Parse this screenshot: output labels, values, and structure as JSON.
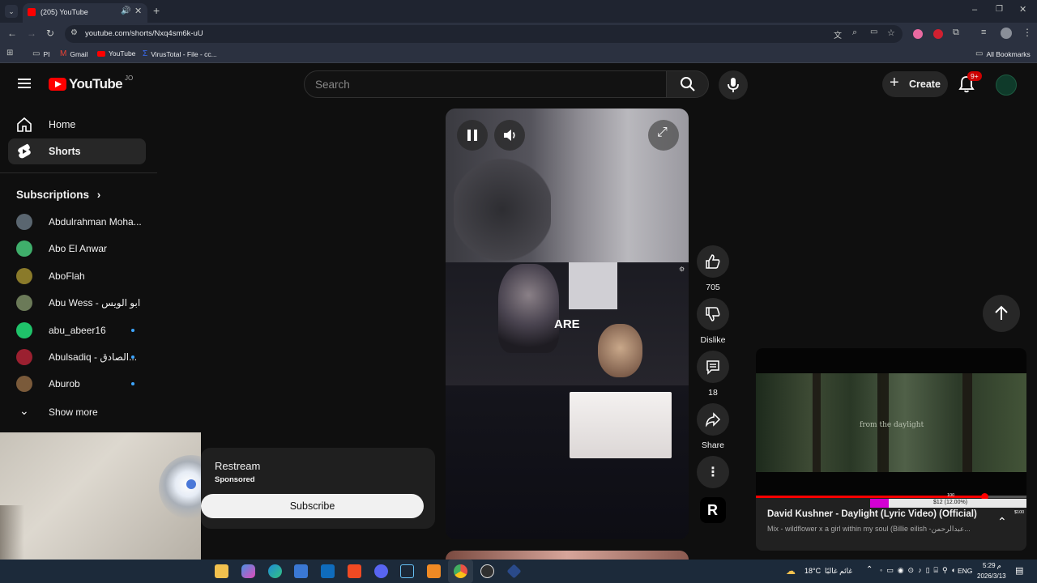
{
  "browser": {
    "tab_title": "(205) YouTube",
    "url": "youtube.com/shorts/Nxq4sm6k-uU",
    "bookmarks": [
      "PI",
      "Gmail",
      "YouTube",
      "VirusTotal - File - cc..."
    ],
    "all_bookmarks": "All Bookmarks"
  },
  "youtube": {
    "logo_text": "YouTube",
    "country_code": "JO",
    "search_placeholder": "Search",
    "create_label": "Create",
    "notifications_badge": "9+",
    "sidebar": {
      "home": "Home",
      "shorts": "Shorts",
      "subscriptions_heading": "Subscriptions",
      "subscriptions": [
        {
          "name": "Abdulrahman Moha...",
          "new": false,
          "color": "#5a6670"
        },
        {
          "name": "Abo El Anwar",
          "new": false,
          "color": "#3fae6b"
        },
        {
          "name": "AboFlah",
          "new": false,
          "color": "#8a7a2a"
        },
        {
          "name": "Abu Wess - ابو الويس",
          "new": false,
          "color": "#6b7a58"
        },
        {
          "name": "abu_abeer16",
          "new": true,
          "color": "#1fc36a"
        },
        {
          "name": "Abulsadiq - الصادق...",
          "new": true,
          "color": "#9b2030"
        },
        {
          "name": "Aburob",
          "new": true,
          "color": "#7a5a3a"
        }
      ],
      "show_more": "Show more"
    },
    "short": {
      "caption": "ARE",
      "likes": "705",
      "dislike_label": "Dislike",
      "comments": "18",
      "share_label": "Share",
      "channel_initial": "R"
    },
    "ad": {
      "advertiser": "Restream",
      "sponsored": "Sponsored",
      "subscribe_label": "Subscribe"
    },
    "miniplayer": {
      "overlay_text": "from the daylight",
      "title": "David Kushner - Daylight (Lyric Video) (Official)",
      "subtitle": "Mix - wildflower x a girl within my soul (Billie eilish -عبدالرحمن...",
      "stream_goal_label": "$12 (12.00%)",
      "goal_top": "100",
      "goal_right": "$100",
      "progress_fraction": 0.12
    }
  },
  "taskbar": {
    "temperature": "18°C",
    "weather_text": "غائم غالبًا",
    "language": "ENG",
    "time": "5:29 م",
    "date": "2026/3/13"
  },
  "colors": {
    "youtube_red": "#ff0000",
    "accent_blue": "#3ea6ff",
    "progress_magenta": "#d400d4"
  }
}
